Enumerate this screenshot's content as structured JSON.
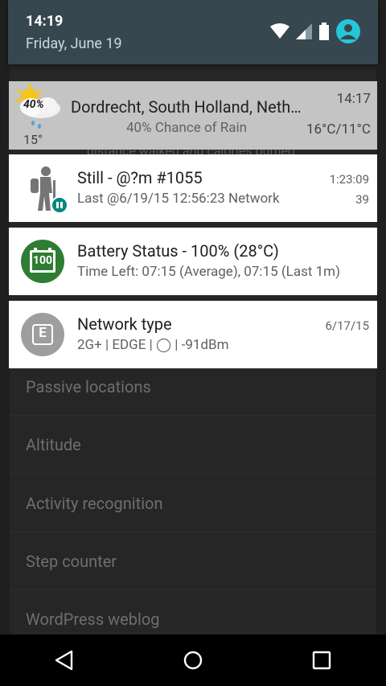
{
  "status_bar": {
    "time": "14:19",
    "date": "Friday, June 19"
  },
  "background_app": {
    "snippet": "distance walked and calories burned",
    "list_items": [
      "Passive locations",
      "Altitude",
      "Activity recognition",
      "Step counter",
      "WordPress weblog"
    ]
  },
  "notifications": {
    "weather": {
      "title": "Dordrecht, South Holland, Neth…",
      "subtitle": "40% Chance of Rain",
      "time": "14:17",
      "range": "16°C/11°C",
      "current_temp": "15°",
      "icon_badge": "40%",
      "icon": "partly-cloudy-rain-icon"
    },
    "activity": {
      "title": "Still - @?m #1055",
      "subtitle": "Last @6/19/15 12:56:23 Network",
      "time": "1:23:09",
      "count": "39",
      "icon": "hiker-icon"
    },
    "battery": {
      "title": "Battery Status - 100% (28°C)",
      "subtitle": "Time Left: 07:15 (Average), 07:15 (Last 1m)",
      "icon_label": "100",
      "icon": "battery-icon"
    },
    "network": {
      "title": "Network type",
      "subtitle": "2G+  |  EDGE  |  ◯  |  -91dBm",
      "date": "6/17/15",
      "icon_label": "E",
      "icon": "network-icon"
    }
  },
  "colors": {
    "shade": "#37474f",
    "accent": "#26c6da",
    "battery_green": "#2e7d32",
    "pause_teal": "#00897b",
    "network_grey": "#9e9e9e"
  }
}
